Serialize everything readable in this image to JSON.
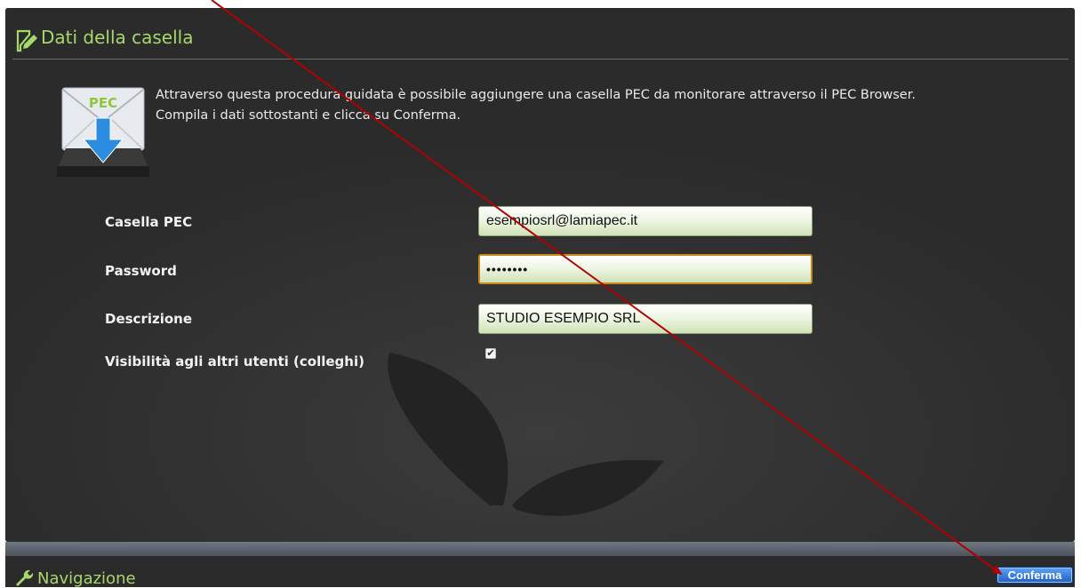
{
  "panel": {
    "title": "Dati della casella",
    "title_icon": "edit-page-icon",
    "intro_line1": "Attraverso questa procedura guidata è possibile aggiungere una casella PEC da monitorare attraverso il PEC Browser.",
    "intro_line2": "Compila i dati sottostanti e clicca su Conferma.",
    "pec_icon_label": "PEC"
  },
  "form": {
    "casella_label": "Casella PEC",
    "casella_value": "esempiosrl@lamiapec.it",
    "password_label": "Password",
    "password_value": "••••••••",
    "descrizione_label": "Descrizione",
    "descrizione_value": "STUDIO ESEMPIO SRL",
    "visibilita_label": "Visibilità agli altri utenti (colleghi)",
    "visibilita_checked": true,
    "visibilita_mark": "✔"
  },
  "nav": {
    "title": "Navigazione",
    "icon": "wrench-icon",
    "confirm_label": "Conferma"
  },
  "colors": {
    "panel_bg": "#2b2b2b",
    "title_green": "#a7d86a",
    "annotation_arrow": "#b00000",
    "button_blue": "#1d5fc7"
  }
}
